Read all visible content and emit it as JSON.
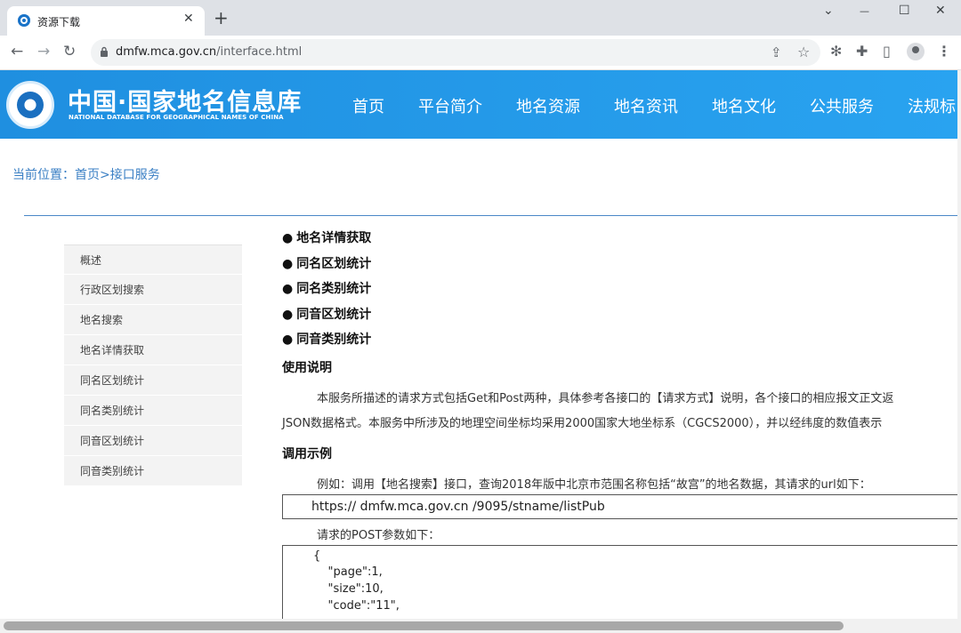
{
  "browser": {
    "tab_title": "资源下载",
    "tab_close": "✕",
    "new_tab": "+",
    "url_host": "dmfw.mca.gov.cn",
    "url_path": "/interface.html",
    "window_controls": {
      "chevron": "⌄",
      "minimize": "—",
      "maximize": "☐",
      "close": "✕"
    },
    "nav": {
      "back": "←",
      "forward": "→",
      "reload": "↻"
    },
    "icons": {
      "share": "⇪",
      "star": "☆",
      "extension_a": "✻",
      "puzzle": "✚",
      "sidepanel": "▯",
      "menu": "⋮"
    }
  },
  "site": {
    "logo_cn": "中国·国家地名信息库",
    "logo_en": "NATIONAL DATABASE FOR GEOGRAPHICAL NAMES OF CHINA",
    "nav_items": [
      "首页",
      "平台简介",
      "地名资源",
      "地名资讯",
      "地名文化",
      "公共服务",
      "法规标"
    ]
  },
  "breadcrumb": "当前位置：首页>接口服务",
  "sidebar": {
    "items": [
      "概述",
      "行政区划搜索",
      "地名搜索",
      "地名详情获取",
      "同名区划统计",
      "同名类别统计",
      "同音区划统计",
      "同音类别统计"
    ]
  },
  "content": {
    "bullet_symbol": "●",
    "bullets": [
      "地名详情获取",
      "同名区划统计",
      "同名类别统计",
      "同音区划统计",
      "同音类别统计"
    ],
    "usage_title": "使用说明",
    "usage_line1": "本服务所描述的请求方式包括Get和Post两种，具体参考各接口的【请求方式】说明，各个接口的相应报文正文返",
    "usage_line2": "JSON数据格式。本服务中所涉及的地理空间坐标均采用2000国家大地坐标系（CGCS2000），并以经纬度的数值表示",
    "example_title": "调用示例",
    "example_line": "例如：调用【地名搜索】接口，查询2018年版中北京市范围名称包括“故宫”的地名数据，其请求的url如下：",
    "example_url": "https:// dmfw.mca.gov.cn /9095/stname/listPub",
    "post_params_label": "请求的POST参数如下：",
    "code_lines": [
      "{",
      "    \"page\":1,",
      "    \"size\":10,",
      "    \"code\":\"11\","
    ]
  }
}
